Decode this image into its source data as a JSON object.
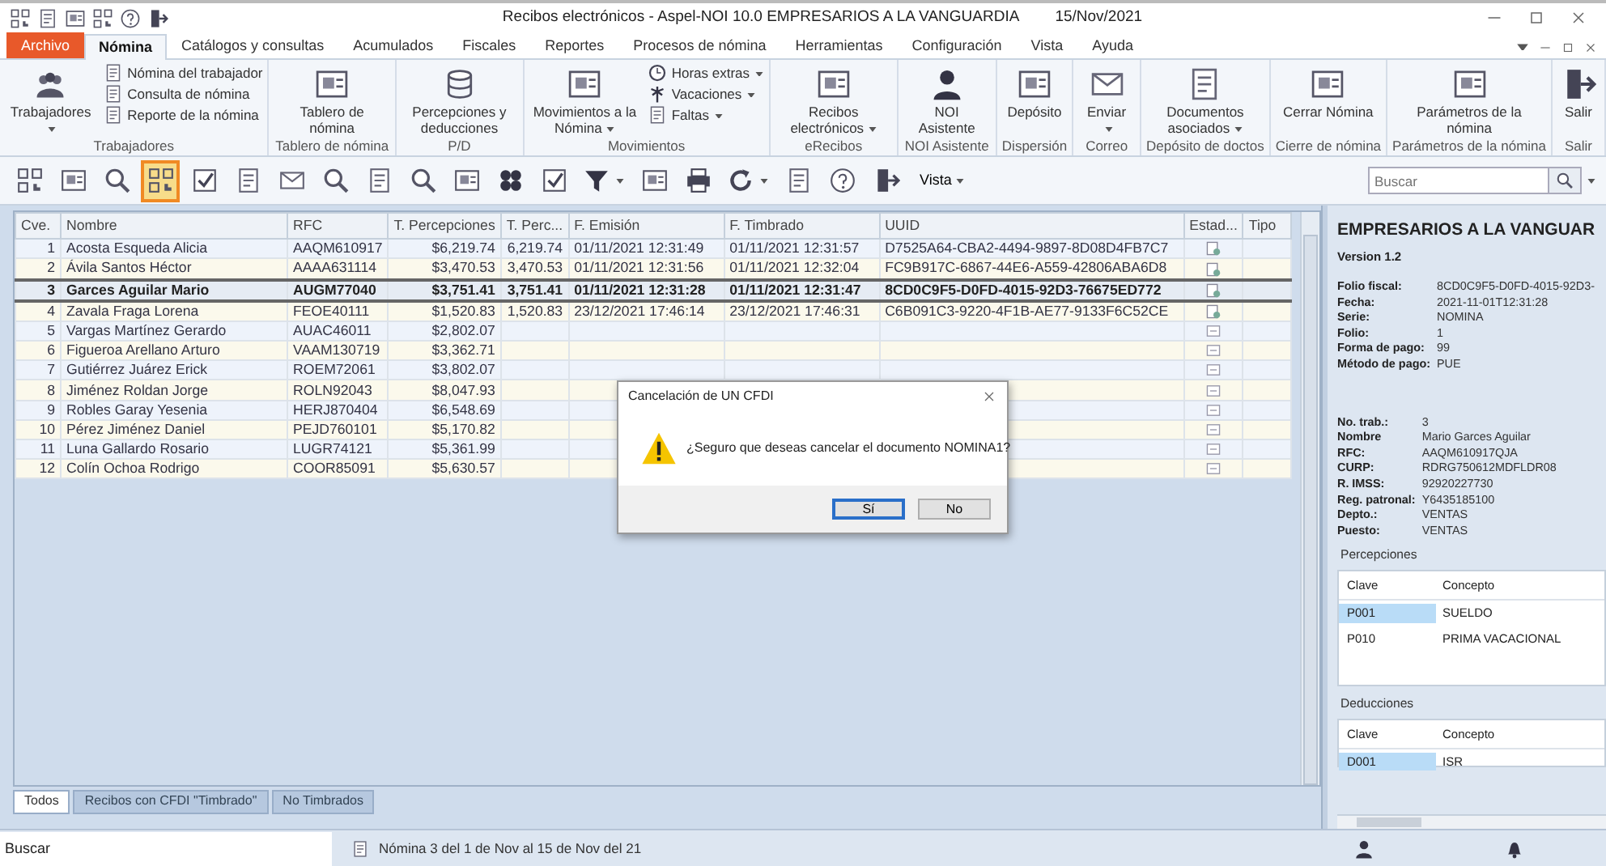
{
  "window": {
    "title": "Recibos electrónicos - Aspel-NOI 10.0  EMPRESARIOS A LA VANGUARDIA",
    "date": "15/Nov/2021"
  },
  "menu_tabs": [
    {
      "label": "Archivo",
      "kind": "file",
      "selected": false
    },
    {
      "label": "Nómina",
      "kind": "tab",
      "selected": true
    },
    {
      "label": "Catálogos y consultas",
      "kind": "tab",
      "selected": false
    },
    {
      "label": "Acumulados",
      "kind": "tab",
      "selected": false
    },
    {
      "label": "Fiscales",
      "kind": "tab",
      "selected": false
    },
    {
      "label": "Reportes",
      "kind": "tab",
      "selected": false
    },
    {
      "label": "Procesos de nómina",
      "kind": "tab",
      "selected": false
    },
    {
      "label": "Herramientas",
      "kind": "tab",
      "selected": false
    },
    {
      "label": "Configuración",
      "kind": "tab",
      "selected": false
    },
    {
      "label": "Vista",
      "kind": "tab",
      "selected": false
    },
    {
      "label": "Ayuda",
      "kind": "tab",
      "selected": false
    }
  ],
  "ribbon": [
    {
      "label": "Trabajadores",
      "buttons": [
        {
          "label": "Trabajadores",
          "kind": "large",
          "dropdown": true
        },
        {
          "label": "Nómina del trabajador",
          "kind": "small",
          "dropdown": false
        },
        {
          "label": "Consulta de nómina",
          "kind": "small",
          "dropdown": false
        },
        {
          "label": "Reporte de la nómina",
          "kind": "small",
          "dropdown": false
        }
      ]
    },
    {
      "label": "Tablero de nómina",
      "buttons": [
        {
          "label": "Tablero de nómina",
          "kind": "large",
          "dropdown": false
        }
      ]
    },
    {
      "label": "P/D",
      "buttons": [
        {
          "label": "Percepciones y deducciones",
          "kind": "large",
          "dropdown": false
        }
      ]
    },
    {
      "label": "Movimientos",
      "buttons": [
        {
          "label": "Movimientos a la Nómina",
          "kind": "large",
          "dropdown": true
        },
        {
          "label": "Horas extras",
          "kind": "small",
          "dropdown": true
        },
        {
          "label": "Vacaciones",
          "kind": "small",
          "dropdown": true
        },
        {
          "label": "Faltas",
          "kind": "small",
          "dropdown": true
        }
      ]
    },
    {
      "label": "eRecibos",
      "buttons": [
        {
          "label": "Recibos electrónicos",
          "kind": "large",
          "dropdown": true
        }
      ]
    },
    {
      "label": "NOI Asistente",
      "buttons": [
        {
          "label": "NOI Asistente",
          "kind": "large",
          "dropdown": false
        }
      ]
    },
    {
      "label": "Dispersión",
      "buttons": [
        {
          "label": "Depósito",
          "kind": "large",
          "dropdown": false
        }
      ]
    },
    {
      "label": "Correo",
      "buttons": [
        {
          "label": "Enviar",
          "kind": "large",
          "dropdown": true
        }
      ]
    },
    {
      "label": "Depósito de doctos",
      "buttons": [
        {
          "label": "Documentos asociados",
          "kind": "large",
          "dropdown": true
        }
      ]
    },
    {
      "label": "Cierre de nómina",
      "buttons": [
        {
          "label": "Cerrar Nómina",
          "kind": "large",
          "dropdown": false
        }
      ]
    },
    {
      "label": "Parámetros de la nómina",
      "buttons": [
        {
          "label": "Parámetros de la nómina",
          "kind": "large",
          "dropdown": false
        }
      ]
    },
    {
      "label": "Salir",
      "buttons": [
        {
          "label": "Salir",
          "kind": "large",
          "dropdown": false
        }
      ]
    }
  ],
  "toolbar": {
    "buttons": [
      {
        "selected": false,
        "dropdown": false
      },
      {
        "selected": false,
        "dropdown": false
      },
      {
        "selected": false,
        "dropdown": false
      },
      {
        "selected": true,
        "dropdown": false
      },
      {
        "selected": false,
        "dropdown": false
      },
      {
        "selected": false,
        "dropdown": false
      },
      {
        "selected": false,
        "dropdown": false
      },
      {
        "selected": false,
        "dropdown": false
      },
      {
        "selected": false,
        "dropdown": false
      },
      {
        "selected": false,
        "dropdown": false
      },
      {
        "selected": false,
        "dropdown": false
      },
      {
        "selected": false,
        "dropdown": false
      },
      {
        "selected": false,
        "dropdown": false
      },
      {
        "selected": false,
        "dropdown": true
      },
      {
        "selected": false,
        "dropdown": false
      },
      {
        "selected": false,
        "dropdown": false
      },
      {
        "selected": false,
        "dropdown": true
      },
      {
        "selected": false,
        "dropdown": false
      },
      {
        "selected": false,
        "dropdown": false
      },
      {
        "selected": false,
        "dropdown": false
      }
    ],
    "view_menu": "Vista",
    "search": {
      "placeholder": "Buscar"
    }
  },
  "table": {
    "columns": [
      "Cve.",
      "Nombre",
      "RFC",
      "T. Percepciones",
      "T. Perc...",
      "F. Emisión",
      "F. Timbrado",
      "UUID",
      "Estad...",
      "Tipo"
    ],
    "rows": [
      {
        "cells": [
          "1",
          "Acosta Esqueda Alicia",
          "AAQM610917",
          "$6,219.74",
          "6,219.74",
          "01/11/2021 12:31:49",
          "01/11/2021 12:31:57",
          "D7525A64-CBA2-4494-9897-8D08D4FB7C7"
        ],
        "stamped": true,
        "selected": false
      },
      {
        "cells": [
          "2",
          "Ávila Santos Héctor",
          "AAAA631114",
          "$3,470.53",
          "3,470.53",
          "01/11/2021 12:31:56",
          "01/11/2021 12:32:04",
          "FC9B917C-6867-44E6-A559-42806ABA6D8"
        ],
        "stamped": true,
        "selected": false
      },
      {
        "cells": [
          "3",
          "Garces Aguilar Mario",
          "AUGM77040",
          "$3,751.41",
          "3,751.41",
          "01/11/2021 12:31:28",
          "01/11/2021 12:31:47",
          "8CD0C9F5-D0FD-4015-92D3-76675ED772"
        ],
        "stamped": true,
        "selected": true
      },
      {
        "cells": [
          "4",
          "Zavala Fraga Lorena",
          "FEOE40111",
          "$1,520.83",
          "1,520.83",
          "23/12/2021 17:46:14",
          "23/12/2021 17:46:31",
          "C6B091C3-9220-4F1B-AE77-9133F6C52CE"
        ],
        "stamped": true,
        "selected": false
      },
      {
        "cells": [
          "5",
          "Vargas Martínez Gerardo",
          "AUAC46011",
          "$2,802.07",
          null,
          null,
          null,
          null
        ],
        "stamped": false,
        "selected": false
      },
      {
        "cells": [
          "6",
          "Figueroa Arellano Arturo",
          "VAAM130719",
          "$3,362.71",
          null,
          null,
          null,
          null
        ],
        "stamped": false,
        "selected": false
      },
      {
        "cells": [
          "7",
          "Gutiérrez Juárez Erick",
          "ROEM72061",
          "$3,802.07",
          null,
          null,
          null,
          null
        ],
        "stamped": false,
        "selected": false
      },
      {
        "cells": [
          "8",
          "Jiménez Roldan Jorge",
          "ROLN92043",
          "$8,047.93",
          null,
          null,
          null,
          null
        ],
        "stamped": false,
        "selected": false
      },
      {
        "cells": [
          "9",
          "Robles Garay Yesenia",
          "HERJ870404",
          "$6,548.69",
          null,
          null,
          null,
          null
        ],
        "stamped": false,
        "selected": false
      },
      {
        "cells": [
          "10",
          "Pérez Jiménez Daniel",
          "PEJD760101",
          "$5,170.82",
          null,
          null,
          null,
          null
        ],
        "stamped": false,
        "selected": false
      },
      {
        "cells": [
          "11",
          "Luna Gallardo Rosario",
          "LUGR74121",
          "$5,361.99",
          null,
          null,
          null,
          null
        ],
        "stamped": false,
        "selected": false
      },
      {
        "cells": [
          "12",
          "Colín Ochoa Rodrigo",
          "COOR85091",
          "$5,630.57",
          null,
          null,
          null,
          null
        ],
        "stamped": false,
        "selected": false
      }
    ]
  },
  "bottom_tabs": [
    {
      "label": "Todos",
      "selected": true
    },
    {
      "label": "Recibos con CFDI \"Timbrado\"",
      "selected": false
    },
    {
      "label": "No Timbrados",
      "selected": false
    }
  ],
  "dialog": {
    "title": "Cancelación de UN CFDI",
    "message": "¿Seguro que deseas cancelar el documento NOMINA1?",
    "buttons": [
      {
        "label": "Sí",
        "selected": true
      },
      {
        "label": "No",
        "selected": false
      }
    ]
  },
  "detail_panel": {
    "title": "EMPRESARIOS A LA VANGUAR",
    "version": "Version 1.2",
    "receipt_fields": [
      {
        "label": "Folio fiscal:",
        "value": "8CD0C9F5-D0FD-4015-92D3-"
      },
      {
        "label": "Fecha:",
        "value": "2021-11-01T12:31:28"
      },
      {
        "label": "Serie:",
        "value": "NOMINA"
      },
      {
        "label": "Folio:",
        "value": "1"
      },
      {
        "label": "Forma de pago:",
        "value": "99"
      },
      {
        "label": "Método de pago:",
        "value": "PUE"
      }
    ],
    "employee_fields": [
      {
        "label": "No. trab.:",
        "value": "3"
      },
      {
        "label": "Nombre",
        "value": "Mario Garces Aguilar"
      },
      {
        "label": "RFC:",
        "value": "AAQM610917QJA"
      },
      {
        "label": "CURP:",
        "value": "RDRG750612MDFLDR08"
      },
      {
        "label": "R. IMSS:",
        "value": "92920227730"
      },
      {
        "label": "Reg. patronal:",
        "value": "Y6435185100"
      },
      {
        "label": "Depto.:",
        "value": "VENTAS"
      },
      {
        "label": "Puesto:",
        "value": "VENTAS"
      }
    ],
    "percepciones": {
      "title": "Percepciones",
      "columns": [
        "Clave",
        "Concepto"
      ],
      "rows": [
        {
          "cells": [
            "P001",
            "SUELDO"
          ],
          "selected": true
        },
        {
          "cells": [
            "P010",
            "PRIMA VACACIONAL"
          ],
          "selected": false
        }
      ]
    },
    "deducciones": {
      "title": "Deducciones",
      "columns": [
        "Clave",
        "Concepto"
      ],
      "rows": [
        {
          "cells": [
            "D001",
            "ISR"
          ],
          "selected": true
        }
      ]
    }
  },
  "status_bar": {
    "search": "Buscar",
    "text": "Nómina  3 del 1 de Nov al 15 de Nov del 21"
  }
}
